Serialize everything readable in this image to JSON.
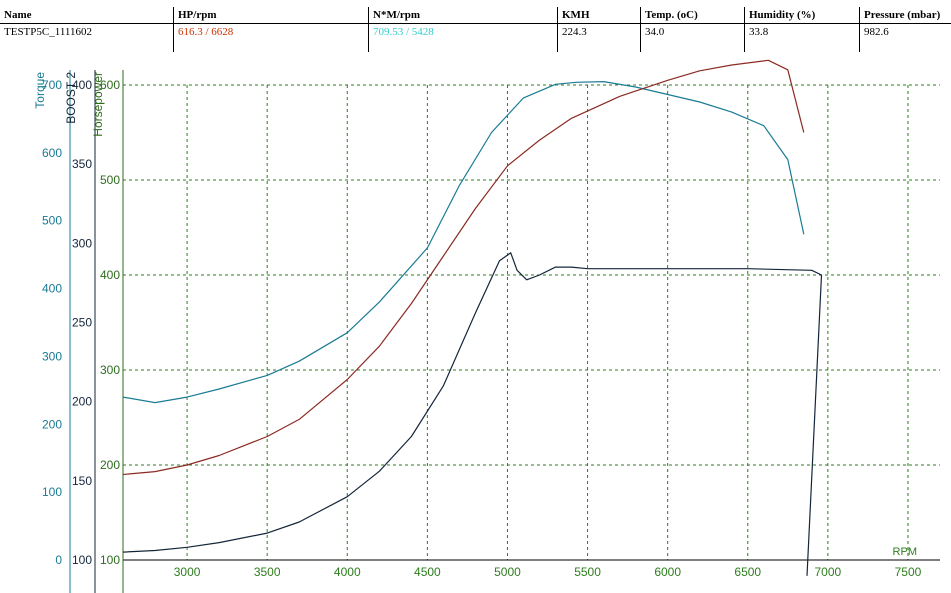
{
  "summary": {
    "headers": [
      "Name",
      "HP/rpm",
      "N*M/rpm",
      "KMH",
      "Temp. (oC)",
      "Humidity (%)",
      "Pressure (mbar)"
    ],
    "name": "TESTP5C_1111602",
    "hp_rpm": "616.3 / 6628",
    "nm_rpm": "709.53 / 5428",
    "kmh": "224.3",
    "temp": "34.0",
    "humidity": "33.8",
    "pressure": "982.6"
  },
  "colors": {
    "hp": "#cc3300",
    "nm": "#33cccc"
  },
  "chart_data": {
    "type": "line",
    "xlabel": "RPM",
    "xlim": [
      2600,
      7700
    ],
    "x_ticks": [
      "3000",
      "3500",
      "4000",
      "4500",
      "5000",
      "5500",
      "6000",
      "6500",
      "7000",
      "7500"
    ],
    "axes": [
      {
        "label": "Torque",
        "ylim": [
          0,
          700
        ],
        "ticks": [
          "0",
          "100",
          "200",
          "300",
          "400",
          "500",
          "600",
          "700"
        ],
        "color": "#1a7b94"
      },
      {
        "label": "BOOST 2",
        "ylim": [
          100,
          400
        ],
        "ticks": [
          "100",
          "150",
          "200",
          "250",
          "300",
          "350",
          "400"
        ],
        "color": "#14263a"
      },
      {
        "label": "Horsepower",
        "ylim": [
          100,
          600
        ],
        "ticks": [
          "100",
          "200",
          "300",
          "400",
          "500",
          "600"
        ],
        "color": "#2e6b1e"
      }
    ],
    "series": [
      {
        "axis": 0,
        "color": "#1a7b94",
        "x": [
          2600,
          2800,
          3000,
          3200,
          3500,
          3700,
          4000,
          4200,
          4500,
          4700,
          4900,
          5100,
          5300,
          5428,
          5600,
          5800,
          6000,
          6200,
          6400,
          6600,
          6750,
          6850
        ],
        "y": [
          240,
          232,
          240,
          252,
          272,
          293,
          335,
          380,
          460,
          552,
          630,
          681,
          701,
          704,
          705,
          697,
          686,
          675,
          660,
          640,
          590,
          480
        ]
      },
      {
        "axis": 1,
        "color": "#14263a",
        "x": [
          2600,
          2800,
          3000,
          3200,
          3500,
          3700,
          4000,
          4200,
          4400,
          4600,
          4800,
          4950,
          5020,
          5060,
          5120,
          5200,
          5300,
          5400,
          5500,
          6000,
          6500,
          6900,
          6960,
          6870
        ],
        "y": [
          105,
          106,
          108,
          111,
          117,
          124,
          140,
          156,
          178,
          210,
          256,
          289,
          294,
          283,
          277,
          280,
          285,
          285,
          284,
          284,
          284,
          283,
          280,
          90
        ]
      },
      {
        "axis": 2,
        "color": "#8b2a22",
        "x": [
          2600,
          2800,
          3000,
          3200,
          3500,
          3700,
          4000,
          4200,
          4400,
          4600,
          4800,
          5000,
          5200,
          5400,
          5700,
          6000,
          6200,
          6400,
          6628,
          6750,
          6850
        ],
        "y": [
          190,
          193,
          200,
          210,
          230,
          248,
          290,
          325,
          370,
          420,
          470,
          515,
          542,
          565,
          588,
          605,
          615,
          621,
          626,
          616,
          550
        ]
      }
    ]
  }
}
